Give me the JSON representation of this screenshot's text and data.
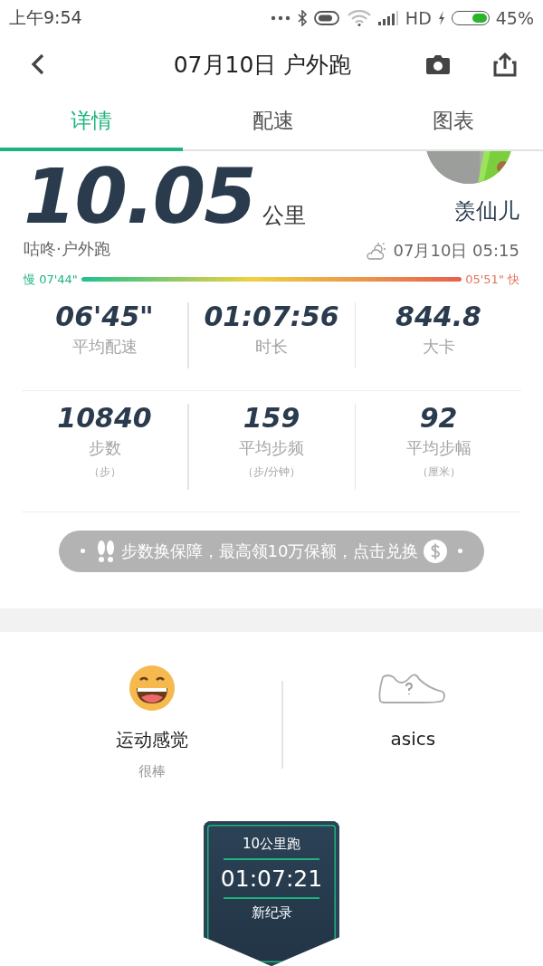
{
  "status_bar": {
    "time": "上午9:54",
    "network": "HD",
    "battery": "45%"
  },
  "nav": {
    "title": "07月10日 户外跑"
  },
  "tabs": [
    {
      "label": "详情",
      "selected": true
    },
    {
      "label": "配速",
      "selected": false
    },
    {
      "label": "图表",
      "selected": false
    }
  ],
  "summary": {
    "distance": "10.05",
    "unit": "公里",
    "user": "羡仙儿",
    "source": "咕咚·户外跑",
    "datetime": "07月10日 05:15"
  },
  "pace_bar": {
    "slow": "慢 07'44\"",
    "fast": "05'51\" 快"
  },
  "stats": [
    {
      "value": "06'45\"",
      "label": "平均配速"
    },
    {
      "value": "01:07:56",
      "label": "时长"
    },
    {
      "value": "844.8",
      "label": "大卡"
    },
    {
      "value": "10840",
      "label": "步数",
      "unit": "（步）"
    },
    {
      "value": "159",
      "label": "平均步频",
      "unit": "（步/分钟）"
    },
    {
      "value": "92",
      "label": "平均步幅",
      "unit": "（厘米）"
    }
  ],
  "banner": {
    "text": "步数换保障，最高领10万保额，点击兑换"
  },
  "extras": [
    {
      "kind": "feeling",
      "title": "运动感觉",
      "subtitle": "很棒"
    },
    {
      "kind": "shoe",
      "title": "asics"
    }
  ],
  "record_badge": {
    "title": "10公里跑",
    "time": "01:07:21",
    "note": "新纪录"
  }
}
